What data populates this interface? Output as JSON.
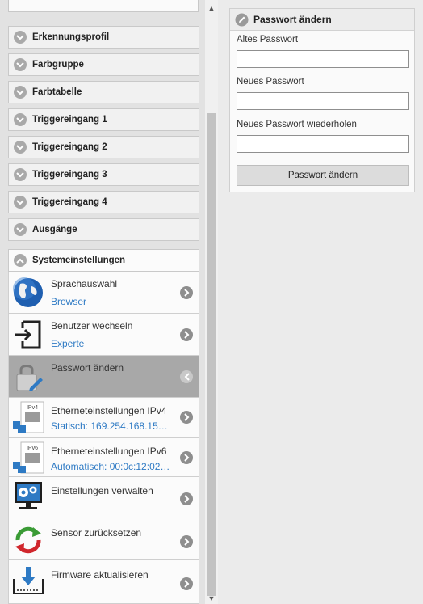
{
  "sidebar": {
    "sections": [
      {
        "label": "Erkennungsprofil",
        "expanded": false
      },
      {
        "label": "Farbgruppe",
        "expanded": false
      },
      {
        "label": "Farbtabelle",
        "expanded": false
      },
      {
        "label": "Triggereingang 1",
        "expanded": false
      },
      {
        "label": "Triggereingang 2",
        "expanded": false
      },
      {
        "label": "Triggereingang 3",
        "expanded": false
      },
      {
        "label": "Triggereingang 4",
        "expanded": false
      },
      {
        "label": "Ausgänge",
        "expanded": false
      },
      {
        "label": "Systemeinstellungen",
        "expanded": true
      }
    ],
    "items": [
      {
        "title": "Sprachauswahl",
        "subtitle": "Browser",
        "icon": "globe-icon"
      },
      {
        "title": "Benutzer wechseln",
        "subtitle": "Experte",
        "icon": "user-switch-icon"
      },
      {
        "title": "Passwort ändern",
        "subtitle": "",
        "icon": "lock-pen-icon",
        "active": true
      },
      {
        "title": "Etherneteinstellungen IPv4",
        "subtitle": "Statisch: 169.254.168.150:...",
        "icon": "network-ipv4-icon",
        "icon_text": "IPv4"
      },
      {
        "title": "Etherneteinstellungen IPv6",
        "subtitle": "Automatisch: 00:0c:12:02:1...",
        "icon": "network-ipv6-icon",
        "icon_text": "IPv6"
      },
      {
        "title": "Einstellungen verwalten",
        "subtitle": "",
        "icon": "settings-monitor-icon"
      },
      {
        "title": "Sensor zurücksetzen",
        "subtitle": "",
        "icon": "reset-arrows-icon"
      },
      {
        "title": "Firmware aktualisieren",
        "subtitle": "",
        "icon": "firmware-download-icon"
      }
    ]
  },
  "panel": {
    "title": "Passwort ändern",
    "fields": [
      {
        "label": "Altes Passwort",
        "value": ""
      },
      {
        "label": "Neues Passwort",
        "value": ""
      },
      {
        "label": "Neues Passwort wiederholen",
        "value": ""
      }
    ],
    "submit_label": "Passwort ändern"
  },
  "colors": {
    "link_blue": "#2e7ac4",
    "active_item": "#a8a8a8",
    "chevron_gray": "#a9a9a9"
  }
}
